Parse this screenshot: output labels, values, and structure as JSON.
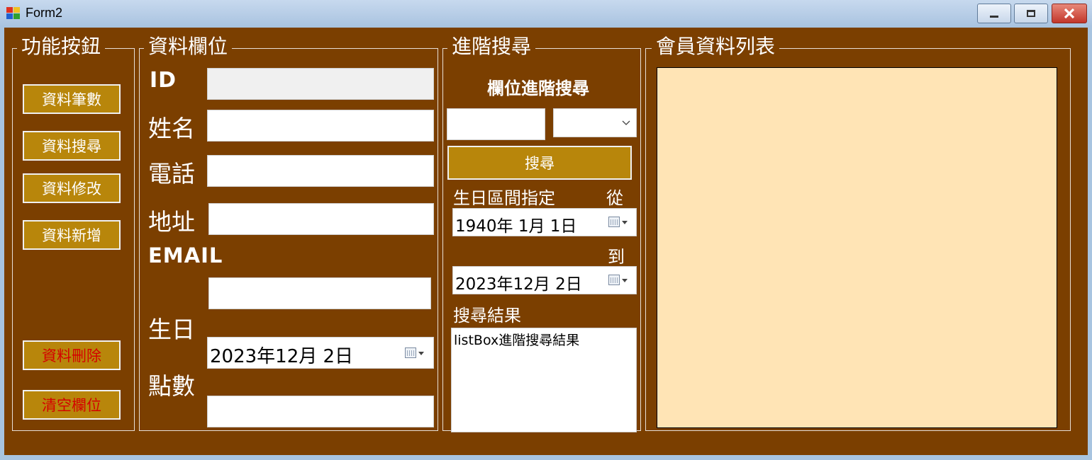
{
  "window": {
    "title": "Form2"
  },
  "groups": {
    "functions": {
      "legend": "功能按鈕"
    },
    "fields": {
      "legend": "資料欄位"
    },
    "advanced": {
      "legend": "進階搜尋"
    },
    "members": {
      "legend": "會員資料列表"
    }
  },
  "buttons": {
    "count": "資料筆數",
    "search": "資料搜尋",
    "edit": "資料修改",
    "add": "資料新增",
    "delete": "資料刪除",
    "clear": "清空欄位"
  },
  "fields": {
    "id_label": "ID",
    "name_label": "姓名",
    "phone_label": "電話",
    "address_label": "地址",
    "email_label": "EMAIL",
    "birthday_label": "生日",
    "points_label": "點數",
    "birthday_value": "2023年12月  2日"
  },
  "advanced": {
    "field_search_label": "欄位進階搜尋",
    "search_button": "搜尋",
    "range_label": "生日區間指定",
    "from_label": "從",
    "from_date": "1940年  1月  1日",
    "to_label": "到",
    "to_date": "2023年12月  2日",
    "results_label": "搜尋結果",
    "results_list_text": "listBox進階搜尋結果"
  },
  "colors": {
    "form_background": "#7b3f00",
    "button_background": "#b8860b",
    "grid_background": "#ffe4b5",
    "warning_text": "#d40000"
  }
}
